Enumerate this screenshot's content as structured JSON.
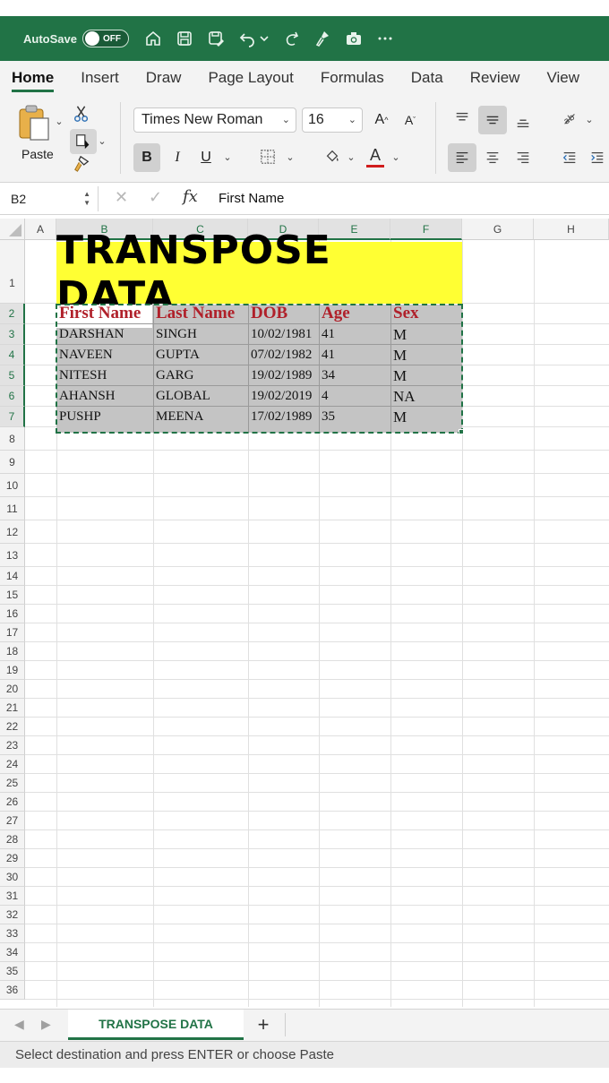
{
  "titlebar": {
    "autosave_label": "AutoSave",
    "toggle_state": "OFF",
    "quick_icons": [
      "home-icon",
      "save-icon",
      "save-as-icon",
      "undo-icon",
      "undo-dropdown-icon",
      "redo-icon",
      "format-painter-icon",
      "camera-icon",
      "more-icon"
    ]
  },
  "ribbon_tabs": [
    "Home",
    "Insert",
    "Draw",
    "Page Layout",
    "Formulas",
    "Data",
    "Review",
    "View"
  ],
  "active_tab": "Home",
  "ribbon": {
    "paste_label": "Paste",
    "font_name": "Times New Roman",
    "font_size": "16",
    "bold": "B",
    "italic": "I",
    "underline": "U",
    "font_color": "#d01c1c",
    "accent_color": "#217346"
  },
  "formula_bar": {
    "name_box": "B2",
    "fx": "fx",
    "content": "First Name"
  },
  "grid": {
    "columns": [
      "A",
      "B",
      "C",
      "D",
      "E",
      "F",
      "G",
      "H"
    ],
    "selected_columns": [
      "B",
      "C",
      "D",
      "E",
      "F"
    ],
    "rows": [
      "1",
      "2",
      "3",
      "4",
      "5",
      "6",
      "7",
      "8",
      "9",
      "10",
      "11",
      "12",
      "13",
      "14",
      "15",
      "16",
      "17",
      "18",
      "19",
      "20",
      "21",
      "22",
      "23",
      "24",
      "25",
      "26",
      "27",
      "28",
      "29",
      "30",
      "31",
      "32",
      "33",
      "34",
      "35",
      "36"
    ],
    "title_cell": "TRANSPOSE DATA",
    "title_fill": "#ffff33",
    "header_row": [
      "First Name",
      "Last Name",
      "DOB",
      "Age",
      "Sex"
    ],
    "data_rows": [
      [
        "DARSHAN",
        "SINGH",
        "10/02/1981",
        "41",
        "M"
      ],
      [
        "NAVEEN",
        "GUPTA",
        "07/02/1982",
        "41",
        "M"
      ],
      [
        "NITESH",
        "GARG",
        "19/02/1989",
        "34",
        "M"
      ],
      [
        "AHANSH",
        "GLOBAL",
        "19/02/2019",
        "4",
        "NA"
      ],
      [
        "PUSHP",
        "MEENA",
        "17/02/1989",
        "35",
        "M"
      ]
    ],
    "header_color": "#b0202a",
    "selection_fill": "#c4c4c4"
  },
  "sheets": {
    "active": "TRANSPOSE DATA",
    "add": "+"
  },
  "status": "Select destination and press ENTER or choose Paste"
}
